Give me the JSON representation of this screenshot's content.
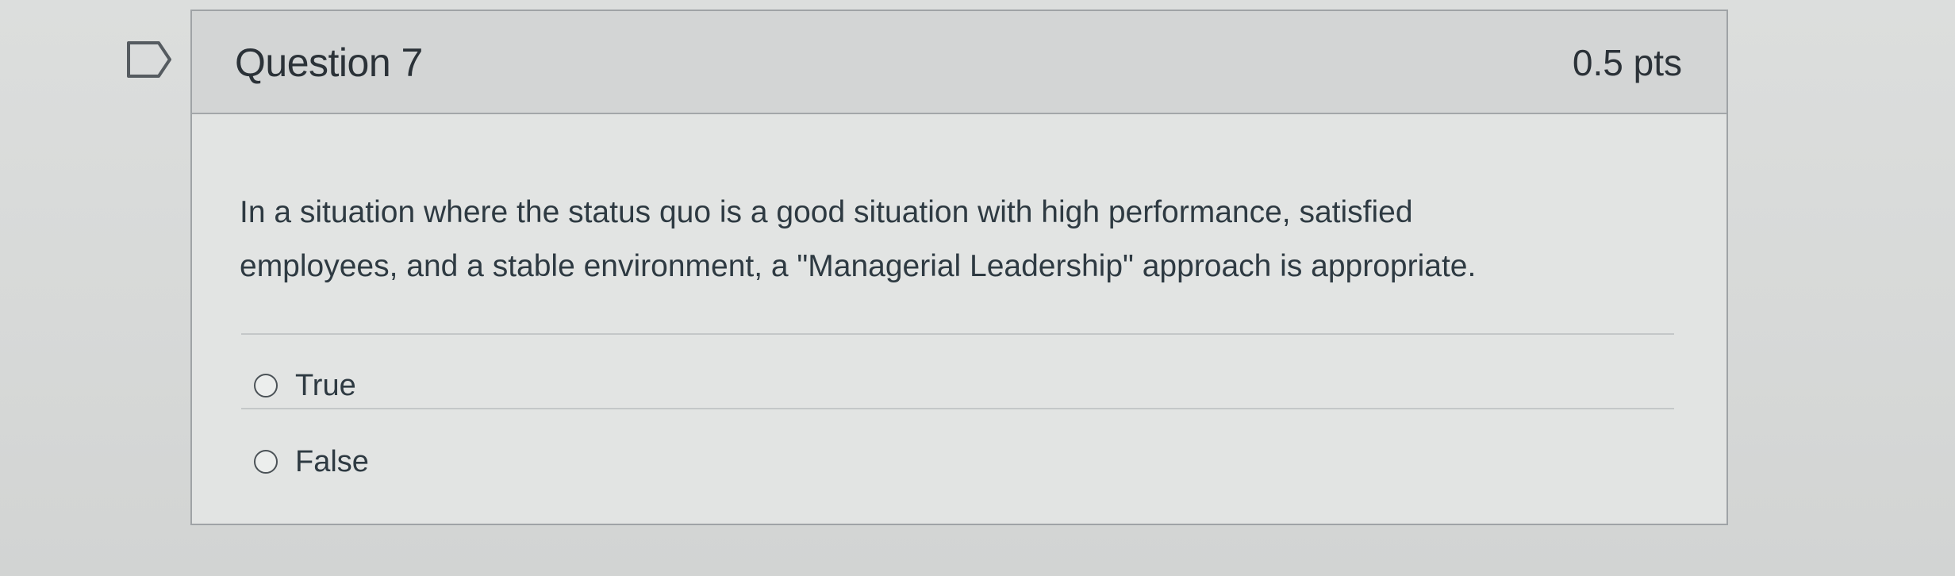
{
  "question": {
    "title": "Question 7",
    "points": "0.5 pts",
    "flag_icon": "flag-icon",
    "text_line1": "In a situation where the status quo is a good situation with high performance, satisfied",
    "text_line2": "employees, and a stable environment, a \"Managerial Leadership\" approach is appropriate.",
    "answers": [
      {
        "label": "True",
        "selected": false
      },
      {
        "label": "False",
        "selected": false
      }
    ]
  },
  "colors": {
    "background": "#d7d9d8",
    "header": "#d3d5d5",
    "card": "#e2e4e3",
    "text": "#2d3b45"
  }
}
